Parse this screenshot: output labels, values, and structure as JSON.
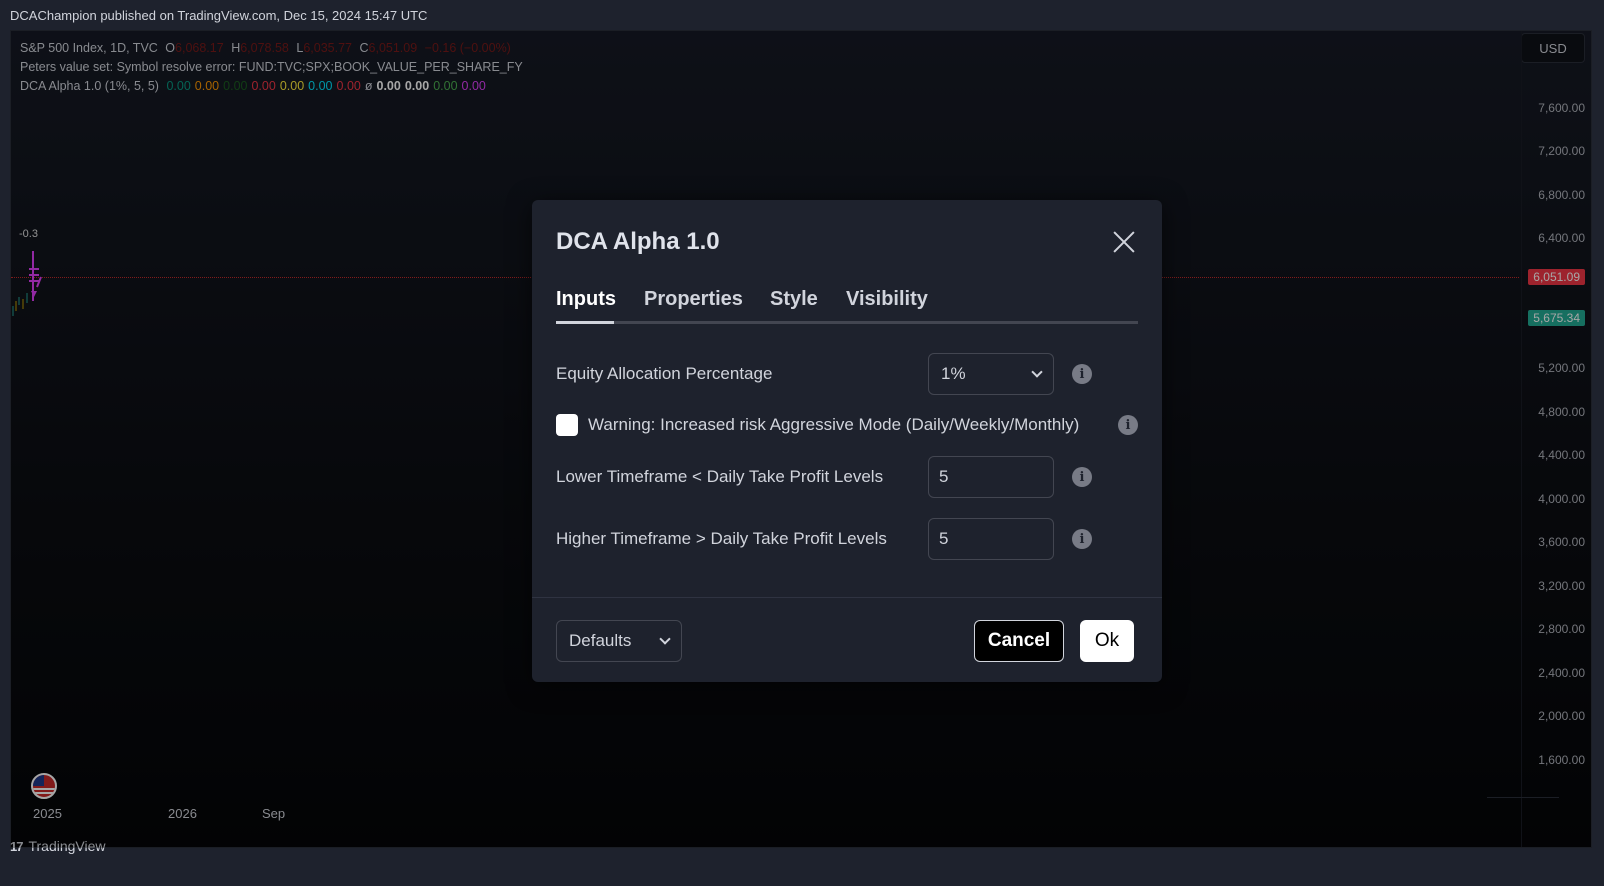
{
  "published_line": "DCAChampion published on TradingView.com, Dec 15, 2024 15:47 UTC",
  "legend": {
    "symbol": "S&P 500 Index, 1D, TVC",
    "o_label": "O",
    "o_value": "6,068.17",
    "h_label": "H",
    "h_value": "6,078.58",
    "l_label": "L",
    "l_value": "6,035.77",
    "c_label": "C",
    "c_value": "6,051.09",
    "change": "−0.16 (−0.00%)",
    "error_line": "Peters value set: Symbol resolve error: FUND:TVC;SPX;BOOK_VALUE_PER_SHARE_FY",
    "indicator_name": "DCA Alpha 1.0 (1%, 5, 5)",
    "indicator_values": [
      {
        "text": "0.00",
        "color": "#089981"
      },
      {
        "text": "0.00",
        "color": "#ff9800"
      },
      {
        "text": "0.00",
        "color": "#1b5e20"
      },
      {
        "text": "0.00",
        "color": "#f23645"
      },
      {
        "text": "0.00",
        "color": "#ffeb3b"
      },
      {
        "text": "0.00",
        "color": "#00e5ff"
      },
      {
        "text": "0.00",
        "color": "#f23645"
      },
      {
        "text": "ø",
        "color": "#d1d4dc"
      },
      {
        "text": "0.00",
        "color": "#ffffff"
      },
      {
        "text": "0.00",
        "color": "#ffffff"
      },
      {
        "text": "0.00",
        "color": "#4caf50"
      },
      {
        "text": "0.00",
        "color": "#e040fb"
      }
    ]
  },
  "currency_button": "USD",
  "price_axis": [
    "7,600.00",
    "7,200.00",
    "6,800.00",
    "6,400.00",
    "5,200.00",
    "4,800.00",
    "4,400.00",
    "4,000.00",
    "3,600.00",
    "3,200.00",
    "2,800.00",
    "2,400.00",
    "2,000.00",
    "1,600.00"
  ],
  "last_price_tag": {
    "text": "6,051.09",
    "color": "#f23645"
  },
  "indicator_price_tag": {
    "text": "5,675.34",
    "color": "#22ab94"
  },
  "time_axis": [
    "2025",
    "2026",
    "Sep"
  ],
  "mini_text": "-0.3",
  "bottom_brand": "TradingView",
  "dialog": {
    "title": "DCA Alpha 1.0",
    "tabs": [
      "Inputs",
      "Properties",
      "Style",
      "Visibility"
    ],
    "active_tab": "Inputs",
    "fields": {
      "equity_label": "Equity Allocation Percentage",
      "equity_value": "1%",
      "warning_label": "Warning: Increased risk Aggressive Mode (Daily/Weekly/Monthly)",
      "lower_label": "Lower Timeframe < Daily Take Profit Levels",
      "lower_value": "5",
      "higher_label": "Higher Timeframe > Daily Take Profit Levels",
      "higher_value": "5"
    },
    "defaults_label": "Defaults",
    "cancel_label": "Cancel",
    "ok_label": "Ok"
  }
}
